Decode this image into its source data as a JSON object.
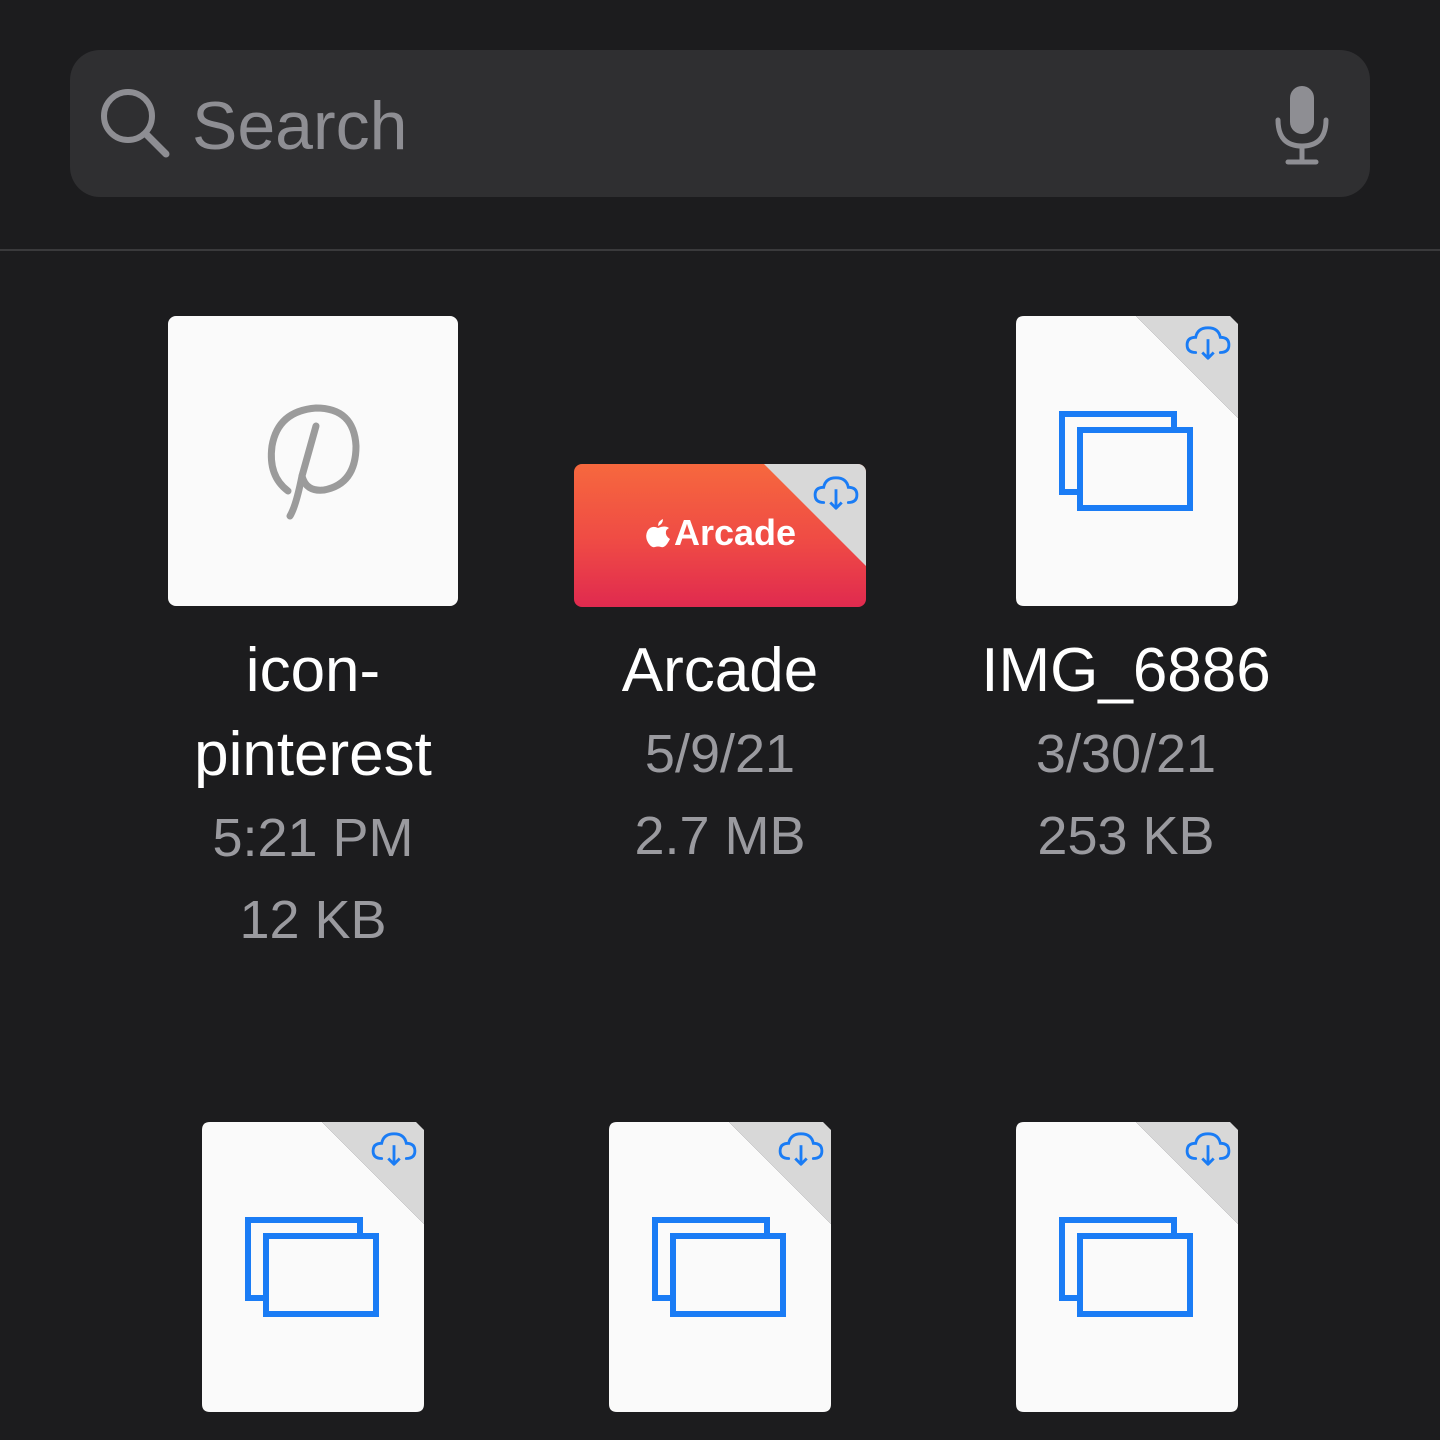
{
  "search": {
    "placeholder": "Search"
  },
  "files": [
    {
      "name_line1": "icon-",
      "name_line2": "pinterest",
      "date": "5:21 PM",
      "size": "12 KB",
      "icon": "pinterest-icon"
    },
    {
      "name": "Arcade",
      "date": "5/9/21",
      "size": "2.7 MB",
      "thumb_text": "Arcade",
      "icon": "apple-icon"
    },
    {
      "name": "IMG_6886",
      "date": "3/30/21",
      "size": "253 KB",
      "icon": "screenshot-doc-icon"
    }
  ],
  "colors": {
    "accent": "#1a7cf5",
    "background": "#1c1c1e",
    "searchbar": "#2f2f31"
  }
}
